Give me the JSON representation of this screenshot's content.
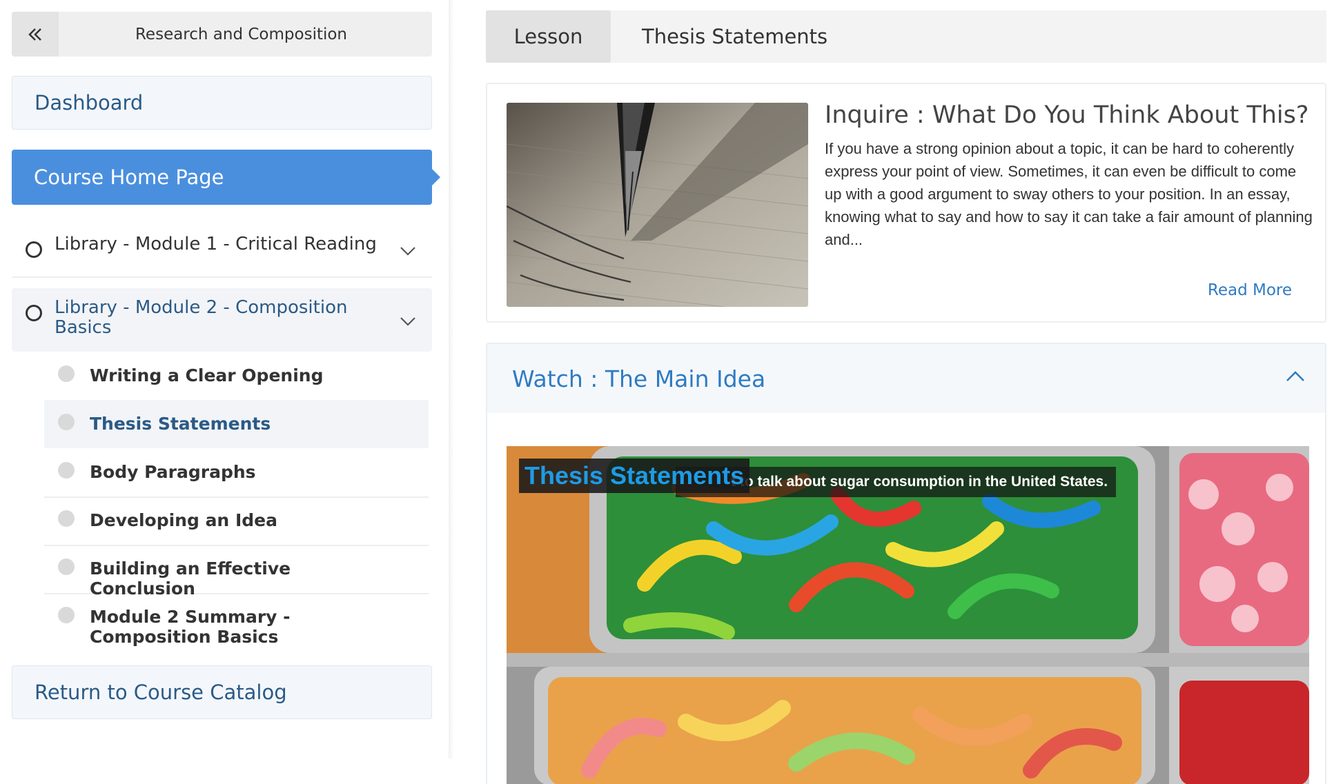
{
  "sidebar": {
    "course_title": "Research and Composition",
    "dashboard_label": "Dashboard",
    "course_home_label": "Course Home Page",
    "modules": [
      {
        "label": "Library - Module 1 - Critical Reading",
        "expanded": false
      },
      {
        "label": "Library - Module 2 - Composition Basics",
        "expanded": true
      }
    ],
    "lessons": [
      {
        "label": "Writing a Clear Opening",
        "active": false
      },
      {
        "label": "Thesis Statements",
        "active": true
      },
      {
        "label": "Body Paragraphs",
        "active": false
      },
      {
        "label": "Developing an Idea",
        "active": false
      },
      {
        "label": "Building an Effective Conclusion",
        "active": false
      },
      {
        "label": "Module 2 Summary - Composition Basics",
        "active": false
      }
    ],
    "return_label": "Return to Course Catalog"
  },
  "tabs": [
    {
      "label": "Lesson",
      "active": true
    },
    {
      "label": "Thesis Statements",
      "active": false
    }
  ],
  "inquire": {
    "title": "Inquire : What Do You Think About This?",
    "body": "If you have a strong opinion about a topic, it can be hard to coherently express your point of view. Sometimes, it can even be difficult to come up with a good argument to sway others to your position. In an essay, knowing what to say and how to say it can take a fair amount of planning and...",
    "read_more": "Read More"
  },
  "watch": {
    "title": "Watch : The Main Idea",
    "expanded": true,
    "video_title": "Thesis Statements",
    "video_caption": "t to talk about sugar consumption in the United States."
  },
  "colors": {
    "accent": "#4a8fde",
    "link": "#2f7bc4",
    "nav_text": "#2b5a86"
  },
  "icons": {
    "collapse": "double-chevron-left-icon",
    "module_status": "circle-outline-icon",
    "lesson_status": "circle-filled-icon",
    "expand": "chevron-down-icon",
    "collapse_section": "chevron-up-icon"
  }
}
